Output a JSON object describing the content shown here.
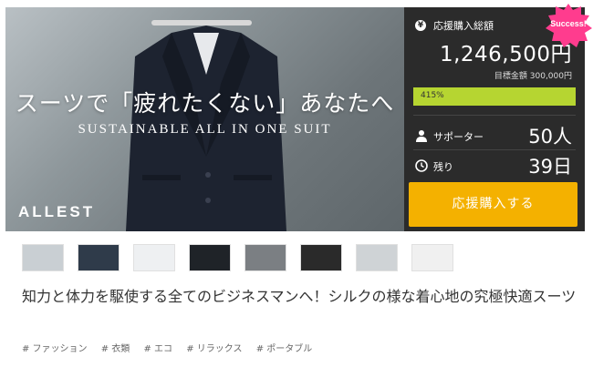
{
  "hero": {
    "headline": "スーツで「疲れたくない」あなたへ",
    "subline": "SUSTAINABLE ALL IN ONE SUIT",
    "logo": "ALLEST"
  },
  "panel": {
    "total_label": "応援購入総額",
    "total_amount": "1,246,500円",
    "goal_text": "目標金額 300,000円",
    "progress_percent_label": "415%",
    "progress_fraction": 1.0,
    "supporters_label": "サポーター",
    "supporters_value": "50人",
    "remaining_label": "残り",
    "remaining_value": "39日",
    "support_button": "応援購入する",
    "colors": {
      "panel_bg": "#2b2b2b",
      "progress": "#b6d531",
      "button": "#f4b100",
      "badge": "#ff3c8e"
    }
  },
  "badge": {
    "label": "Success!"
  },
  "product": {
    "title": "知力と体力を駆使する全てのビジネスマンへ！シルクの様な着心地の究極快適スーツ",
    "tags": [
      "# ファッション",
      "# 衣類",
      "# エコ",
      "# リラックス",
      "# ポータブル"
    ]
  },
  "thumbnails": [
    {
      "name": "thumb-1",
      "tone": "#c9cfd3"
    },
    {
      "name": "thumb-2",
      "tone": "#2f3b4a"
    },
    {
      "name": "thumb-3",
      "tone": "#eef0f2"
    },
    {
      "name": "thumb-4",
      "tone": "#1f2328"
    },
    {
      "name": "thumb-5",
      "tone": "#7b7f83"
    },
    {
      "name": "thumb-6",
      "tone": "#2a2a2a"
    },
    {
      "name": "thumb-7",
      "tone": "#cfd3d6"
    },
    {
      "name": "thumb-8",
      "tone": "#f0f0f0"
    }
  ]
}
